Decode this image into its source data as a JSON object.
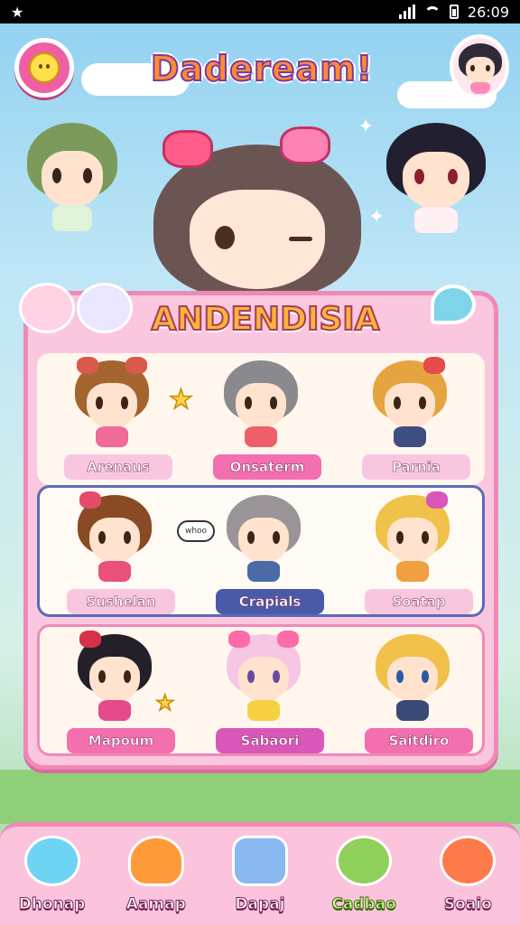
{
  "status_bar": {
    "time": "26:09"
  },
  "header": {
    "title": "Dadeream!"
  },
  "panel": {
    "title": "ANDENDISIA"
  },
  "characters": [
    [
      {
        "name": "Arenaus"
      },
      {
        "name": "Onsaterm"
      },
      {
        "name": "Parnia"
      }
    ],
    [
      {
        "name": "Sushelan"
      },
      {
        "name": "Crapials"
      },
      {
        "name": "Soatap"
      }
    ],
    [
      {
        "name": "Mapoum"
      },
      {
        "name": "Sabaori"
      },
      {
        "name": "Saitdiro"
      }
    ]
  ],
  "speech_bubble": "whoo",
  "bottom_nav": [
    {
      "label": "Dhonap",
      "icon": "star-icon"
    },
    {
      "label": "Aamap",
      "icon": "robot-icon"
    },
    {
      "label": "Dapaj",
      "icon": "message-icon"
    },
    {
      "label": "Cadbao",
      "icon": "bear-icon",
      "active": true
    },
    {
      "label": "Soaio",
      "icon": "pet-icon"
    }
  ],
  "colors": {
    "accent": "#f089b8",
    "panel": "#fbc7de",
    "selected": "#4a5aa8"
  }
}
